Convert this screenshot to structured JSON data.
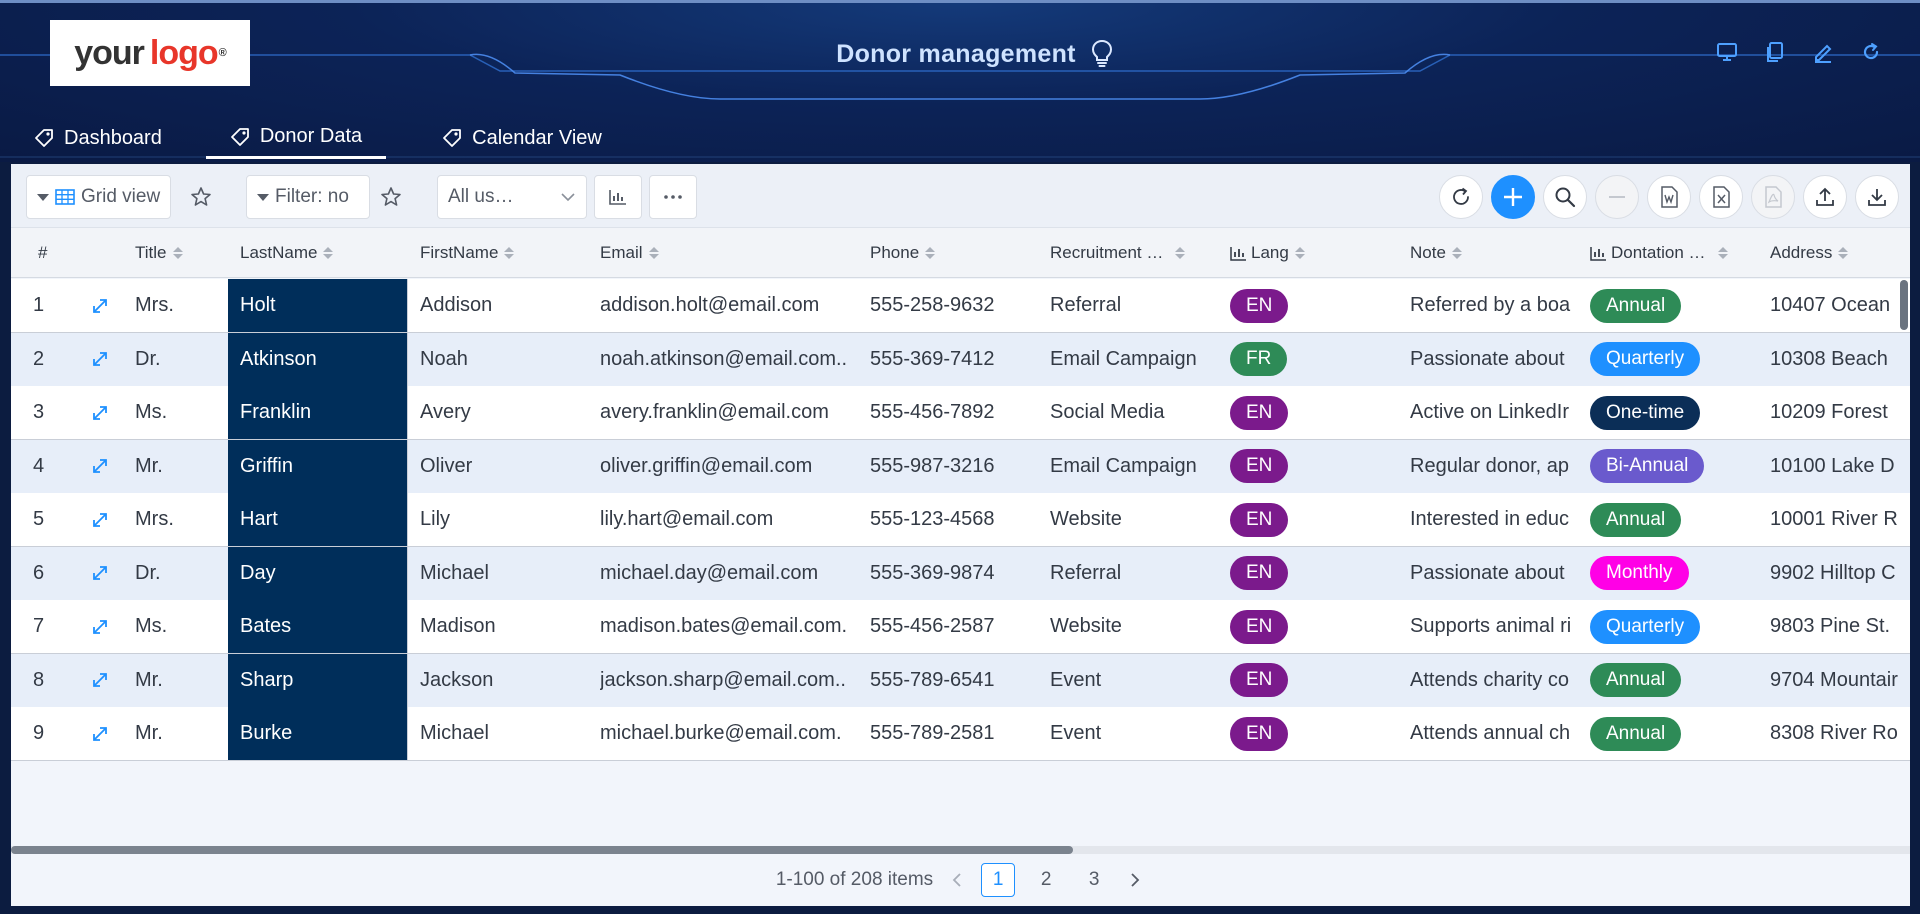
{
  "header": {
    "logo": {
      "part1": "your",
      "part2": "logo",
      "mark": "®"
    },
    "title": "Donor management",
    "title_icon": "lightbulb-icon",
    "tools": [
      "monitor-icon",
      "copy-icon",
      "edit-icon",
      "refresh-icon"
    ]
  },
  "tabs": [
    {
      "label": "Dashboard",
      "icon": "tag-icon",
      "active": false
    },
    {
      "label": "Donor Data",
      "icon": "tag-icon",
      "active": true
    },
    {
      "label": "Calendar View",
      "icon": "tag-icon",
      "active": false
    }
  ],
  "toolbar": {
    "view_label": "Grid view",
    "filter_label": "Filter: no",
    "user_select": "All us…",
    "right_icons": [
      "refresh-icon",
      "plus-icon",
      "search-icon",
      "minus-icon",
      "word-icon",
      "excel-icon",
      "pdf-icon",
      "upload-icon",
      "download-icon"
    ]
  },
  "table": {
    "columns": [
      "#",
      "Title",
      "LastName",
      "FirstName",
      "Email",
      "Phone",
      "Recruitment …",
      "Lang",
      "Note",
      "Dontation …",
      "Address"
    ],
    "rows": [
      {
        "n": "1",
        "title": "Mrs.",
        "last": "Holt",
        "first": "Addison",
        "email": "addison.holt@email.com",
        "phone": "555-258-9632",
        "recruit": "Referral",
        "lang": "EN",
        "note": "Referred by a boa",
        "donation": "Annual",
        "address": "10407 Ocean"
      },
      {
        "n": "2",
        "title": "Dr.",
        "last": "Atkinson",
        "first": "Noah",
        "email": "noah.atkinson@email.com..",
        "phone": "555-369-7412",
        "recruit": "Email Campaign",
        "lang": "FR",
        "note": "Passionate about",
        "donation": "Quarterly",
        "address": "10308 Beach"
      },
      {
        "n": "3",
        "title": "Ms.",
        "last": "Franklin",
        "first": "Avery",
        "email": "avery.franklin@email.com",
        "phone": "555-456-7892",
        "recruit": "Social Media",
        "lang": "EN",
        "note": "Active on LinkedIr",
        "donation": "One-time",
        "address": "10209 Forest"
      },
      {
        "n": "4",
        "title": "Mr.",
        "last": "Griffin",
        "first": "Oliver",
        "email": "oliver.griffin@email.com",
        "phone": "555-987-3216",
        "recruit": "Email Campaign",
        "lang": "EN",
        "note": "Regular donor, ap",
        "donation": "Bi-Annual",
        "address": "10100 Lake D"
      },
      {
        "n": "5",
        "title": "Mrs.",
        "last": "Hart",
        "first": "Lily",
        "email": "lily.hart@email.com",
        "phone": "555-123-4568",
        "recruit": "Website",
        "lang": "EN",
        "note": "Interested in educ",
        "donation": "Annual",
        "address": "10001 River R"
      },
      {
        "n": "6",
        "title": "Dr.",
        "last": "Day",
        "first": "Michael",
        "email": "michael.day@email.com",
        "phone": "555-369-9874",
        "recruit": "Referral",
        "lang": "EN",
        "note": "Passionate about",
        "donation": "Monthly",
        "address": "9902 Hilltop C"
      },
      {
        "n": "7",
        "title": "Ms.",
        "last": "Bates",
        "first": "Madison",
        "email": "madison.bates@email.com.",
        "phone": "555-456-2587",
        "recruit": "Website",
        "lang": "EN",
        "note": "Supports animal ri",
        "donation": "Quarterly",
        "address": "9803 Pine St."
      },
      {
        "n": "8",
        "title": "Mr.",
        "last": "Sharp",
        "first": "Jackson",
        "email": "jackson.sharp@email.com..",
        "phone": "555-789-6541",
        "recruit": "Event",
        "lang": "EN",
        "note": "Attends charity co",
        "donation": "Annual",
        "address": "9704 Mountair"
      },
      {
        "n": "9",
        "title": "Mr.",
        "last": "Burke",
        "first": "Michael",
        "email": "michael.burke@email.com.",
        "phone": "555-789-2581",
        "recruit": "Event",
        "lang": "EN",
        "note": "Attends annual ch",
        "donation": "Annual",
        "address": "8308 River Ro"
      }
    ]
  },
  "colors": {
    "lang": {
      "EN": "#7b1a8c",
      "FR": "#2e8b57"
    },
    "donation": {
      "Annual": "#2e8b57",
      "Quarterly": "#1e90ff",
      "One-time": "#0b2e57",
      "Bi-Annual": "#6a5acd",
      "Monthly": "#ff00e6"
    },
    "lastname_bg": "#002e5a",
    "accent": "#1e90ff"
  },
  "pagination": {
    "summary": "1-100 of 208 items",
    "pages": [
      "1",
      "2",
      "3"
    ],
    "current": "1"
  }
}
